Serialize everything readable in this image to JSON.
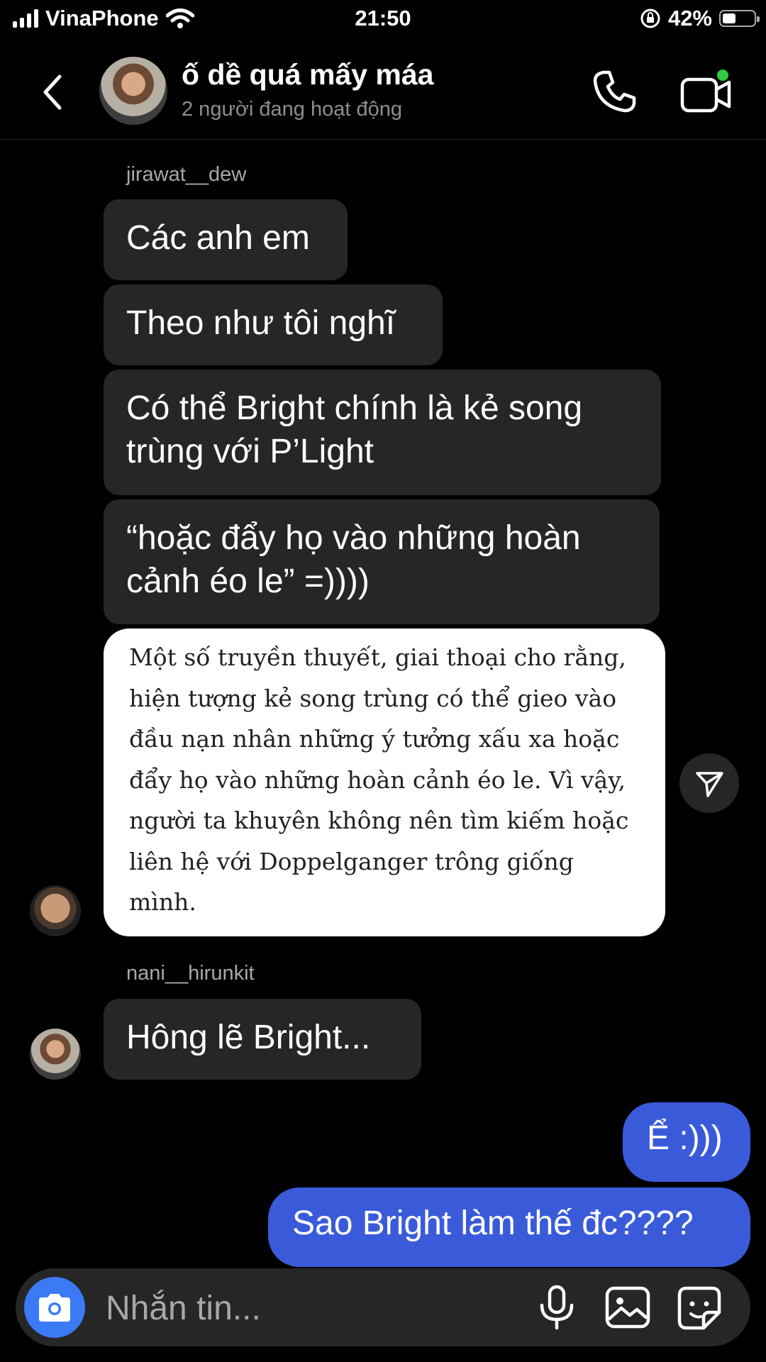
{
  "status_bar": {
    "carrier": "VinaPhone",
    "time": "21:50",
    "battery_text": "42%",
    "battery_level": 0.42
  },
  "header": {
    "title": "ố dề quá mấy máa",
    "subtitle": "2 người đang hoạt động"
  },
  "messages": [
    {
      "sender": "jirawat__dew"
    },
    {
      "text": "Các anh em"
    },
    {
      "text": "Theo như tôi nghĩ"
    },
    {
      "text": "Có thể Bright chính là kẻ song trùng với P’Light"
    },
    {
      "text": "“hoặc đẩy họ vào những hoàn cảnh éo le” =))))"
    },
    {
      "shared_text": "Một số truyền thuyết, giai thoại cho rằng, hiện tượng kẻ song trùng có thể gieo vào đầu nạn nhân những ý tưởng xấu xa hoặc đẩy họ vào những hoàn cảnh éo le. Vì vậy, người ta khuyên không nên tìm kiếm hoặc liên hệ với Doppelganger trông giống mình."
    },
    {
      "sender": "nani__hirunkit"
    },
    {
      "text": "Hông lẽ Bright..."
    },
    {
      "text": "Ể :)))"
    },
    {
      "text": "Sao Bright làm thế đc????"
    }
  ],
  "composer": {
    "placeholder": "Nhắn tin..."
  },
  "colors": {
    "background": "#000000",
    "incoming_bubble": "#262626",
    "outgoing_bubble": "#3a5bd9",
    "camera_button": "#3a7bf5",
    "active_dot": "#2ecc40"
  },
  "icons": [
    "back-icon",
    "phone-icon",
    "video-call-icon",
    "send-icon",
    "camera-icon",
    "microphone-icon",
    "gallery-icon",
    "sticker-icon"
  ]
}
